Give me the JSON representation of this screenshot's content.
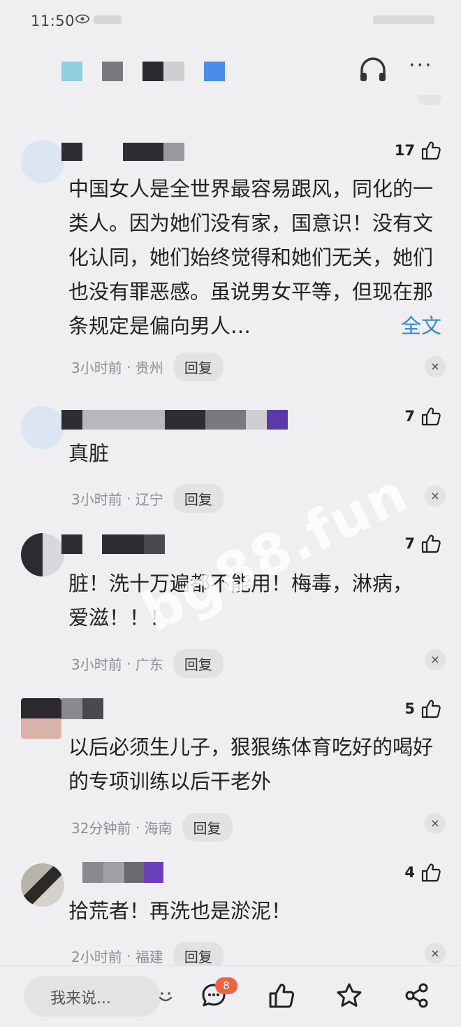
{
  "status_bar": {
    "time": "11:50"
  },
  "comments": [
    {
      "likes": "17",
      "text": "中国女人是全世界最容易跟风，同化的一类人。因为她们没有家，国意识！没有文化认同，她们始终觉得和她们无关，她们也没有罪恶感。虽说男女平等，但现在那条规定是偏向男人…",
      "full_text_link": "全文",
      "time": "3小时前",
      "location": "贵州",
      "reply_label": "回复"
    },
    {
      "likes": "7",
      "text": "真脏",
      "time": "3小时前",
      "location": "辽宁",
      "reply_label": "回复"
    },
    {
      "likes": "7",
      "text": "脏！洗十万遍都不能用！梅毒，淋病，爱滋！！！",
      "time": "3小时前",
      "location": "广东",
      "reply_label": "回复"
    },
    {
      "likes": "5",
      "text": "以后必须生儿子，狠狠练体育吃好的喝好的专项训练以后干老外",
      "time": "32分钟前",
      "location": "海南",
      "reply_label": "回复"
    },
    {
      "likes": "4",
      "text": "拾荒者！再洗也是淤泥！",
      "time": "2小时前",
      "location": "福建",
      "reply_label": "回复"
    }
  ],
  "meta_separator": "·",
  "close_symbol": "×",
  "watermark": "bg88.fun",
  "bottom_bar": {
    "input_placeholder": "我来说...",
    "comment_badge": "8"
  },
  "colors": {
    "background": "#efeff1",
    "link": "#3a86d4",
    "badge": "#f06342"
  }
}
